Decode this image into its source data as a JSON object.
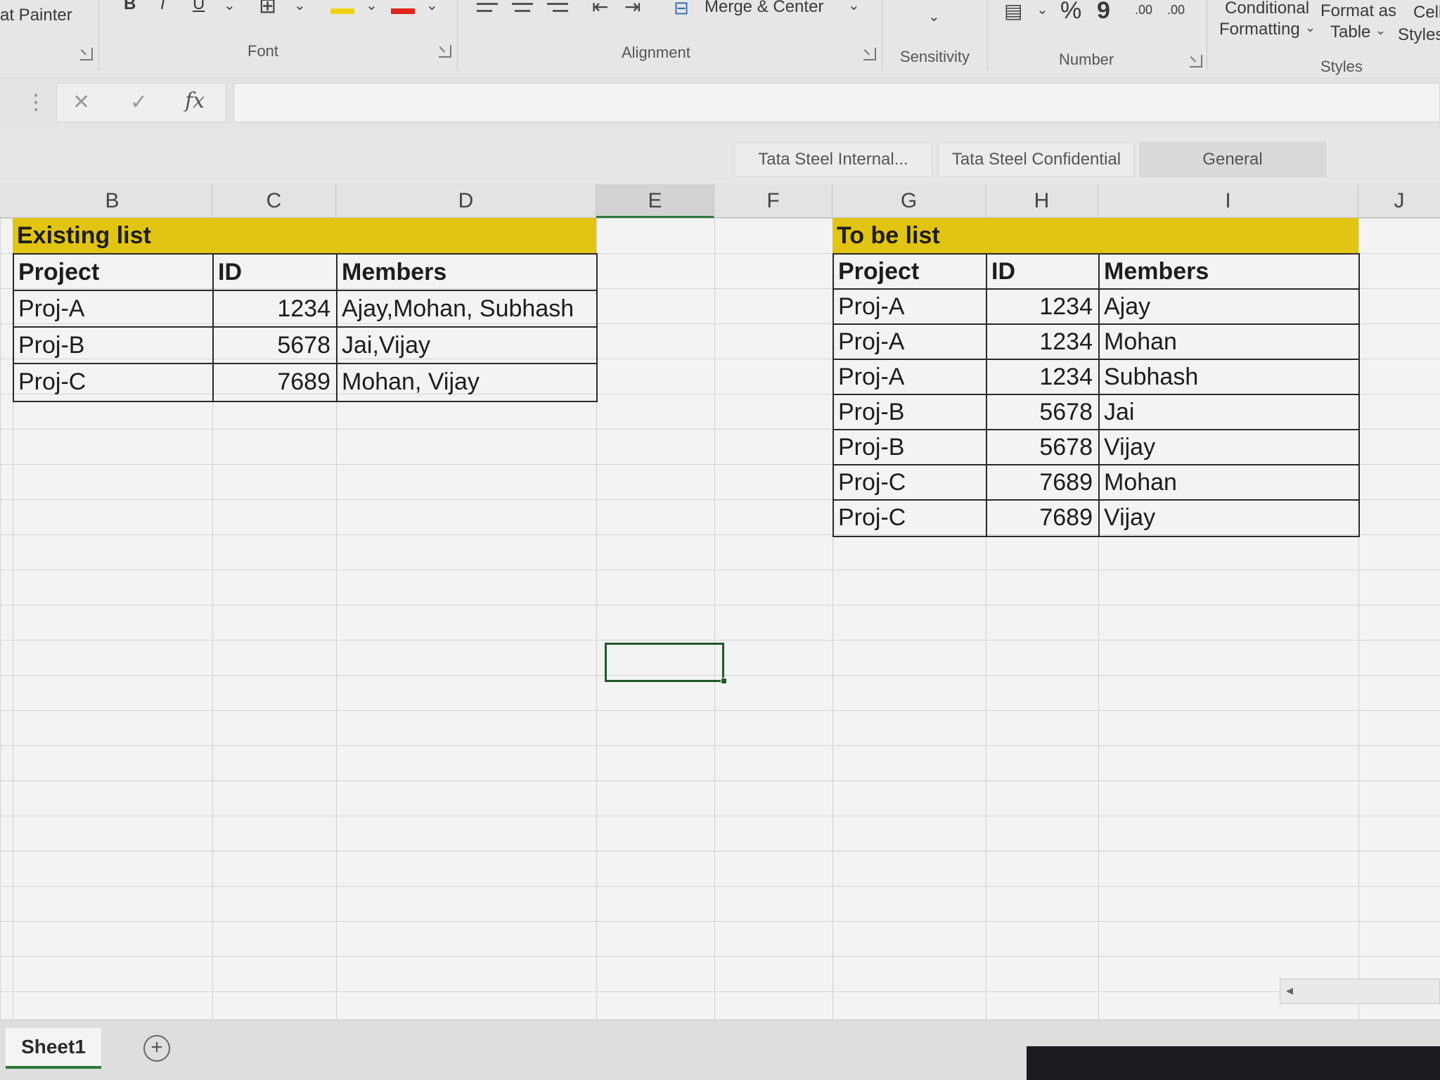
{
  "ribbon": {
    "clipboard": {
      "format_painter": "at Painter"
    },
    "font": {
      "label": "Font",
      "bold": "B",
      "italic": "I",
      "underline": "U",
      "fill_color": "#f2d20b",
      "font_color": "#e0261b"
    },
    "alignment": {
      "label": "Alignment",
      "merge_center": "Merge & Center"
    },
    "sensitivity": {
      "label": "Sensitivity"
    },
    "number": {
      "label": "Number",
      "percent": "%",
      "comma": "9",
      "inc_decimal": ".00",
      "dec_decimal": ".00"
    },
    "styles": {
      "label": "Styles",
      "conditional_1": "Conditional",
      "conditional_2": "Formatting",
      "format_table_1": "Format as",
      "format_table_2": "Table",
      "cell_styles_1": "Cell",
      "cell_styles_2": "Styles"
    }
  },
  "formula_bar": {
    "cancel": "✕",
    "enter": "✓",
    "fx": "fx",
    "value": ""
  },
  "sensitivity_labels": [
    "Tata Steel Internal...",
    "Tata Steel Confidential",
    "General"
  ],
  "columns": [
    "B",
    "C",
    "D",
    "E",
    "F",
    "G",
    "H",
    "I",
    "J"
  ],
  "selected_column": "E",
  "existing_list": {
    "title": "Existing list",
    "headers": [
      "Project",
      "ID",
      "Members"
    ],
    "rows": [
      [
        "Proj-A",
        "1234",
        "Ajay,Mohan, Subhash"
      ],
      [
        "Proj-B",
        "5678",
        "Jai,Vijay"
      ],
      [
        "Proj-C",
        "7689",
        "Mohan, Vijay"
      ]
    ]
  },
  "to_be_list": {
    "title": "To be list",
    "headers": [
      "Project",
      "ID",
      "Members"
    ],
    "rows": [
      [
        "Proj-A",
        "1234",
        "Ajay"
      ],
      [
        "Proj-A",
        "1234",
        "Mohan"
      ],
      [
        "Proj-A",
        "1234",
        "Subhash"
      ],
      [
        "Proj-B",
        "5678",
        "Jai"
      ],
      [
        "Proj-B",
        "5678",
        "Vijay"
      ],
      [
        "Proj-C",
        "7689",
        "Mohan"
      ],
      [
        "Proj-C",
        "7689",
        "Vijay"
      ]
    ]
  },
  "sheet_tabs": {
    "active": "Sheet1",
    "add": "+"
  },
  "colors": {
    "title_band": "#e2c513",
    "selection": "#1f5a2a",
    "tab_accent": "#2f7a3a"
  }
}
